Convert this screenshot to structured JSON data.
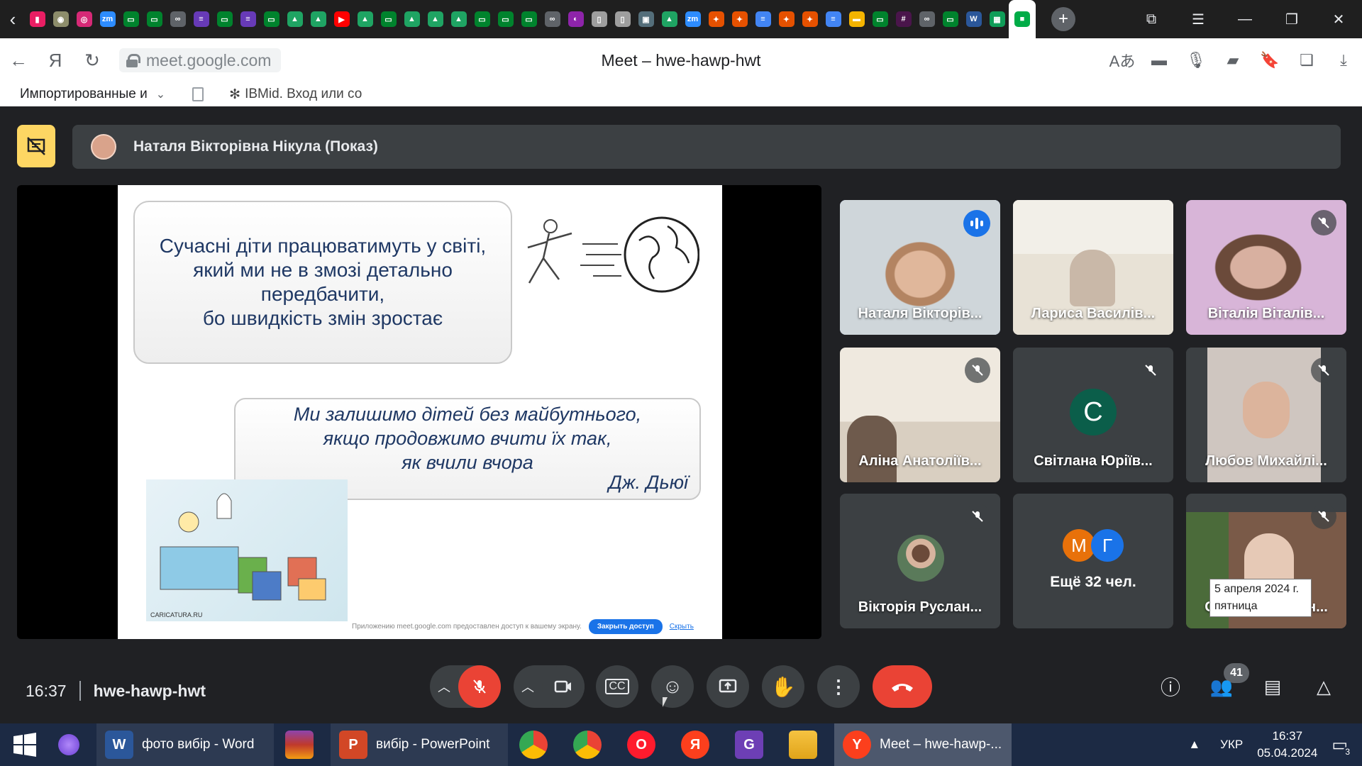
{
  "browser": {
    "title": "Meet – hwe-hawp-hwt",
    "url": "meet.google.com",
    "pinned_tabs": [
      {
        "icon": "pink-tab-icon",
        "color": "#e91e63",
        "glyph": "▮"
      },
      {
        "icon": "emblem-tab-icon",
        "color": "#8d8d6b",
        "glyph": "◉"
      },
      {
        "icon": "instagram-tab-icon",
        "color": "#d62976",
        "glyph": "◎"
      },
      {
        "icon": "zoom-tab-icon",
        "color": "#2d8cff",
        "glyph": "zm"
      },
      {
        "icon": "meet-tab-icon",
        "color": "#00832d",
        "glyph": "▭"
      },
      {
        "icon": "meet-tab-icon",
        "color": "#00832d",
        "glyph": "▭"
      },
      {
        "icon": "link-tab-icon",
        "color": "#5f6368",
        "glyph": "∞"
      },
      {
        "icon": "forms-tab-icon",
        "color": "#673ab7",
        "glyph": "≡"
      },
      {
        "icon": "meet-tab-icon",
        "color": "#00832d",
        "glyph": "▭"
      },
      {
        "icon": "forms-tab-icon",
        "color": "#673ab7",
        "glyph": "≡"
      },
      {
        "icon": "meet-tab-icon",
        "color": "#00832d",
        "glyph": "▭"
      },
      {
        "icon": "drive-tab-icon",
        "color": "#1fa463",
        "glyph": "▲"
      },
      {
        "icon": "drive-tab-icon",
        "color": "#1fa463",
        "glyph": "▲"
      },
      {
        "icon": "youtube-tab-icon",
        "color": "#ff0000",
        "glyph": "▶"
      },
      {
        "icon": "drive-tab-icon",
        "color": "#1fa463",
        "glyph": "▲"
      },
      {
        "icon": "meet-tab-icon",
        "color": "#00832d",
        "glyph": "▭"
      },
      {
        "icon": "drive-tab-icon",
        "color": "#1fa463",
        "glyph": "▲"
      },
      {
        "icon": "drive-tab-icon",
        "color": "#1fa463",
        "glyph": "▲"
      },
      {
        "icon": "drive-tab-icon",
        "color": "#1fa463",
        "glyph": "▲"
      },
      {
        "icon": "meet-tab-icon",
        "color": "#00832d",
        "glyph": "▭"
      },
      {
        "icon": "meet-tab-icon",
        "color": "#00832d",
        "glyph": "▭"
      },
      {
        "icon": "meet-tab-icon",
        "color": "#00832d",
        "glyph": "▭"
      },
      {
        "icon": "link-tab-icon",
        "color": "#5f6368",
        "glyph": "∞"
      },
      {
        "icon": "arc-tab-icon",
        "color": "#8e24aa",
        "glyph": "◐"
      },
      {
        "icon": "doc-tab-icon",
        "color": "#9e9e9e",
        "glyph": "▯"
      },
      {
        "icon": "doc-tab-icon",
        "color": "#9e9e9e",
        "glyph": "▯"
      },
      {
        "icon": "site-tab-icon",
        "color": "#546e7a",
        "glyph": "▣"
      },
      {
        "icon": "drive-tab-icon",
        "color": "#1fa463",
        "glyph": "▲"
      },
      {
        "icon": "zoom-tab-icon",
        "color": "#2d8cff",
        "glyph": "zm"
      },
      {
        "icon": "star-tab-icon",
        "color": "#e65100",
        "glyph": "✦"
      },
      {
        "icon": "star-tab-icon",
        "color": "#e65100",
        "glyph": "✦"
      },
      {
        "icon": "docs-tab-icon",
        "color": "#4285f4",
        "glyph": "≡"
      },
      {
        "icon": "star-tab-icon",
        "color": "#e65100",
        "glyph": "✦"
      },
      {
        "icon": "star-tab-icon",
        "color": "#e65100",
        "glyph": "✦"
      },
      {
        "icon": "docs-tab-icon",
        "color": "#4285f4",
        "glyph": "≡"
      },
      {
        "icon": "slides-tab-icon",
        "color": "#f4b400",
        "glyph": "▬"
      },
      {
        "icon": "meet-tab-icon",
        "color": "#00832d",
        "glyph": "▭"
      },
      {
        "icon": "slack-tab-icon",
        "color": "#4a154b",
        "glyph": "#"
      },
      {
        "icon": "link-tab-icon",
        "color": "#5f6368",
        "glyph": "∞"
      },
      {
        "icon": "meet-tab-icon",
        "color": "#00832d",
        "glyph": "▭"
      },
      {
        "icon": "word-tab-icon",
        "color": "#2b579a",
        "glyph": "W"
      },
      {
        "icon": "classroom-tab-icon",
        "color": "#0f9d58",
        "glyph": "▦"
      },
      {
        "icon": "meet-active-tab-icon",
        "color": "#00ac47",
        "glyph": "■"
      }
    ],
    "bookmarks": {
      "imported": "Импортированные и",
      "ibmid": "IBMid. Вход или со"
    }
  },
  "meet": {
    "presenter_label": "Наталя Вікторівна Нікула (Показ)",
    "slide": {
      "box1_lines": [
        "Сучасні діти працюватимуть у світі,",
        "який ми не в змозі детально",
        "передбачити,",
        "бо швидкість змін зростає"
      ],
      "box2_lines": [
        "Ми залишимо дітей без майбутнього,",
        "якщо продовжимо вчити їх так,",
        "як вчили вчора"
      ],
      "author": "Дж. Дьюї",
      "cartoon_caption": "CARICATURA.RU",
      "share_notice": "Приложению meet.google.com предоставлен доступ к вашему экрану.",
      "share_stop": "Закрыть доступ",
      "share_hide": "Скрыть"
    },
    "tiles": [
      {
        "name": "Наталя Вікторів...",
        "kind": "video",
        "speaking": true
      },
      {
        "name": "Лариса Василів...",
        "kind": "video"
      },
      {
        "name": "Віталія Віталів...",
        "kind": "video",
        "muted": true
      },
      {
        "name": "Аліна Анатоліїв...",
        "kind": "video",
        "muted": true
      },
      {
        "name": "Світлана Юріїв...",
        "kind": "initial",
        "initial": "С",
        "muted": true
      },
      {
        "name": "Любов Михайлі...",
        "kind": "video",
        "muted": true
      },
      {
        "name": "Вікторія Руслан...",
        "kind": "avatar",
        "muted": true
      },
      {
        "name": "Ещё 32 чел.",
        "kind": "more",
        "initials": [
          "М",
          "Г"
        ]
      },
      {
        "name": "Світлана Роман...",
        "kind": "video",
        "muted": true
      }
    ],
    "time": "16:37",
    "meeting_code": "hwe-hawp-hwt",
    "participants_count": "41",
    "date_tooltip": [
      "5 апреля 2024 г.",
      "пятница"
    ]
  },
  "taskbar": {
    "apps": [
      {
        "label": "фото вибір - Word",
        "icon": "W",
        "color": "#2b579a"
      },
      {
        "label": "вибір - PowerPoint",
        "icon": "P",
        "color": "#d24726"
      },
      {
        "label": "Meet – hwe-hawp-...",
        "icon": "Y",
        "color": "#fc3f1d"
      }
    ],
    "lang": "УКР",
    "time": "16:37",
    "date": "05.04.2024",
    "notifications": "3"
  },
  "colors": {
    "accent": "#8ab4f8",
    "danger": "#ea4335",
    "present_yellow": "#fdd663"
  }
}
